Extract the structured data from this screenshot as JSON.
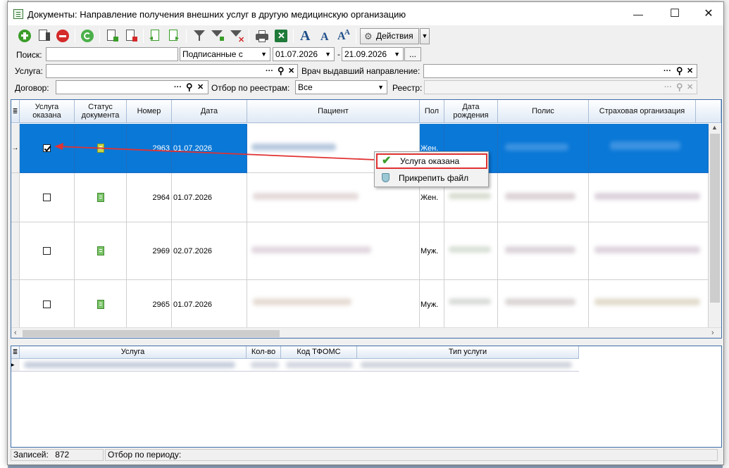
{
  "window": {
    "title": "Документы: Направление получения внешних услуг в другую медицинскую организацию",
    "minimize": "—",
    "maximize": "☐",
    "close": "✕"
  },
  "toolbar": {
    "actions_label": "Действия",
    "font_big": "A",
    "font_small": "A",
    "font_reset": "A",
    "font_sup": "A"
  },
  "filters": {
    "search_label": "Поиск:",
    "search_value": "",
    "status_select": "Подписанные с",
    "date_from": "01.07.2026",
    "date_sep": "-",
    "date_to": "21.09.2026",
    "date_more": "...",
    "service_label": "Услуга:",
    "service_value": "",
    "doctor_label": "Врач выдавший направление:",
    "doctor_value": "",
    "contract_label": "Договор:",
    "contract_value": "",
    "registry_filter_label": "Отбор по реестрам:",
    "registry_filter_value": "Все",
    "registry_label": "Реестр:",
    "registry_value": "",
    "ellipsis": "···",
    "magnifier": "⚲",
    "clear": "✕"
  },
  "grid": {
    "columns": [
      "Услуга оказана",
      "Статус документа",
      "Номер",
      "Дата",
      "Пациент",
      "Пол",
      "Дата рождения",
      "Полис",
      "Страховая организация"
    ],
    "rows": [
      {
        "number": "2963",
        "date": "01.07.2026",
        "gender": "Жен.",
        "service_done": true,
        "selected": true,
        "row_marker": "→"
      },
      {
        "number": "2964",
        "date": "01.07.2026",
        "gender": "Жен.",
        "service_done": false,
        "selected": false,
        "row_marker": ""
      },
      {
        "number": "2969",
        "date": "02.07.2026",
        "gender": "Муж.",
        "service_done": false,
        "selected": false,
        "row_marker": ""
      },
      {
        "number": "2965",
        "date": "01.07.2026",
        "gender": "Муж.",
        "service_done": false,
        "selected": false,
        "row_marker": ""
      }
    ]
  },
  "context_menu": {
    "items": [
      {
        "label": "Услуга оказана",
        "icon": "check-icon"
      },
      {
        "label": "Прикрепить файл",
        "icon": "shield-icon"
      }
    ]
  },
  "subgrid": {
    "columns": [
      "Услуга",
      "Кол-во",
      "Код ТФОМС",
      "Тип услуги"
    ]
  },
  "status": {
    "records_label": "Записей:",
    "records_count": "872",
    "period_label": "Отбор по периоду:",
    "period_value": ""
  },
  "colors": {
    "selection": "#0a78d7",
    "accent_red": "#e03232",
    "grid_border": "#3c6ea8"
  }
}
